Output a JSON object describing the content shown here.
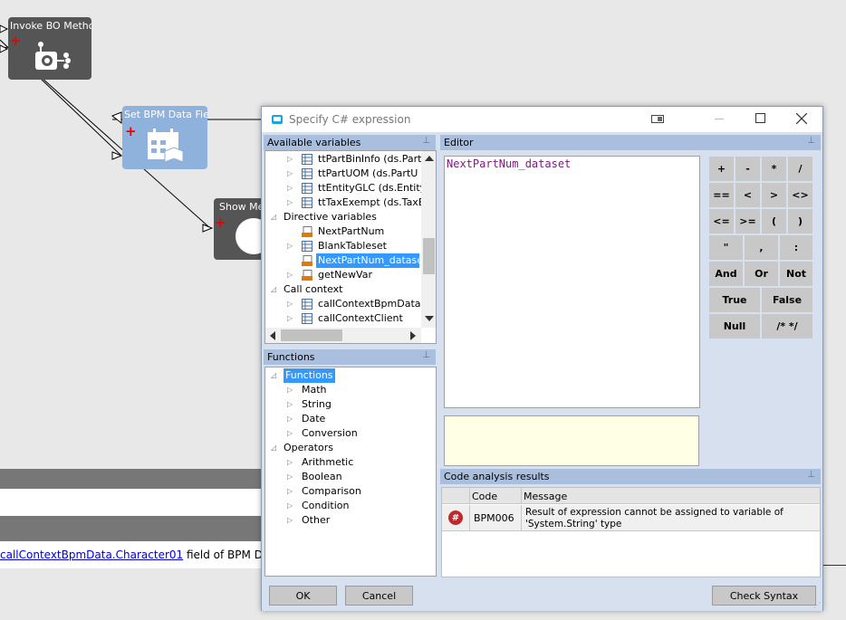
{
  "canvas": {
    "node_invoke": "Invoke BO Method",
    "node_setbpm": "Set BPM Data Fielc",
    "node_show": "Show Mes",
    "bottom_link": "callContextBpmData.Character01",
    "bottom_rest": " field of BPM Data to t"
  },
  "dialog": {
    "title": "Specify C# expression",
    "vars_header": "Available variables",
    "editor_header": "Editor",
    "functions_header": "Functions",
    "code_header": "Code analysis results",
    "editor_text": "NextPartNum_dataset",
    "vars_items": [
      {
        "label": "ttPartBinInfo (ds.Part"
      },
      {
        "label": "ttPartUOM (ds.PartU"
      },
      {
        "label": "ttEntityGLC (ds.Entity"
      },
      {
        "label": "ttTaxExempt (ds.TaxE"
      },
      {
        "label": "Directive variables"
      },
      {
        "label": "NextPartNum"
      },
      {
        "label": "BlankTableset"
      },
      {
        "label": "NextPartNum_datase"
      },
      {
        "label": "getNewVar"
      },
      {
        "label": "Call context"
      },
      {
        "label": "callContextBpmData"
      },
      {
        "label": "callContextClient"
      }
    ],
    "func_items": [
      {
        "label": "Functions"
      },
      {
        "label": "Math"
      },
      {
        "label": "String"
      },
      {
        "label": "Date"
      },
      {
        "label": "Conversion"
      },
      {
        "label": "Operators"
      },
      {
        "label": "Arithmetic"
      },
      {
        "label": "Boolean"
      },
      {
        "label": "Comparison"
      },
      {
        "label": "Condition"
      },
      {
        "label": "Other"
      }
    ],
    "keypad": [
      "+",
      "-",
      "*",
      "/",
      "==",
      "<",
      ">",
      "<>",
      "<=",
      ">=",
      "(",
      ")",
      "\"",
      ",",
      ":",
      "And",
      "Or",
      "Not",
      "True",
      "False",
      "Null",
      "/* */"
    ],
    "grid": {
      "col_code": "Code",
      "col_message": "Message",
      "row_code": "BPM006",
      "row_message_1": "Result of expression cannot be assigned to variable of",
      "row_message_2": "'System.String' type"
    },
    "ok_label": "OK",
    "cancel_label": "Cancel",
    "check_label": "Check Syntax"
  },
  "colors": {
    "selection": "#3399ff",
    "panel_header": "#a9bfdd",
    "client": "#d6e0ee",
    "node_dark": "#555555",
    "node_blue": "#8fb2dc"
  }
}
